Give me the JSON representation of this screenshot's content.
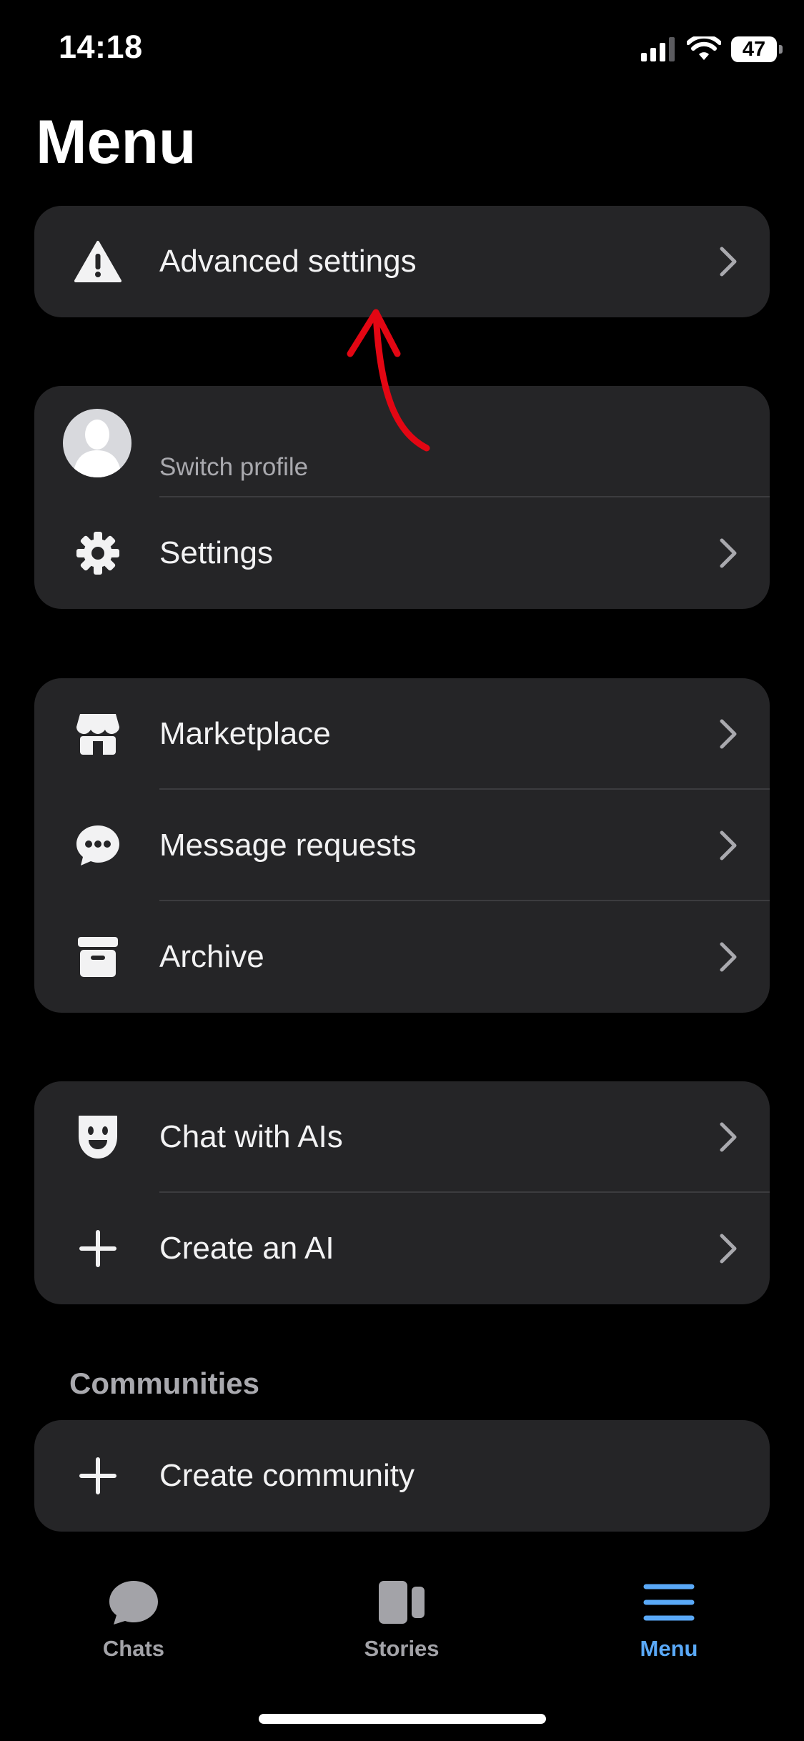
{
  "status_bar": {
    "time": "14:18",
    "battery": "47"
  },
  "page": {
    "title": "Menu"
  },
  "advanced": {
    "label": "Advanced settings"
  },
  "profile": {
    "switch_label": "Switch profile",
    "settings_label": "Settings"
  },
  "group_main": {
    "items": [
      {
        "label": "Marketplace",
        "icon": "store-icon"
      },
      {
        "label": "Message requests",
        "icon": "chat-bubble-dots-icon"
      },
      {
        "label": "Archive",
        "icon": "archive-box-icon"
      }
    ]
  },
  "group_ai": {
    "items": [
      {
        "label": "Chat with AIs",
        "icon": "ai-face-icon"
      },
      {
        "label": "Create an AI",
        "icon": "plus-icon"
      }
    ]
  },
  "communities": {
    "title": "Communities",
    "create_label": "Create community"
  },
  "tabs": [
    {
      "label": "Chats",
      "icon": "chat-bubble-icon",
      "active": false
    },
    {
      "label": "Stories",
      "icon": "stories-icon",
      "active": false
    },
    {
      "label": "Menu",
      "icon": "menu-icon",
      "active": true
    }
  ],
  "colors": {
    "background": "#000000",
    "card": "#252527",
    "accent": "#5aa9f8",
    "annotation_arrow": "#e30613"
  }
}
